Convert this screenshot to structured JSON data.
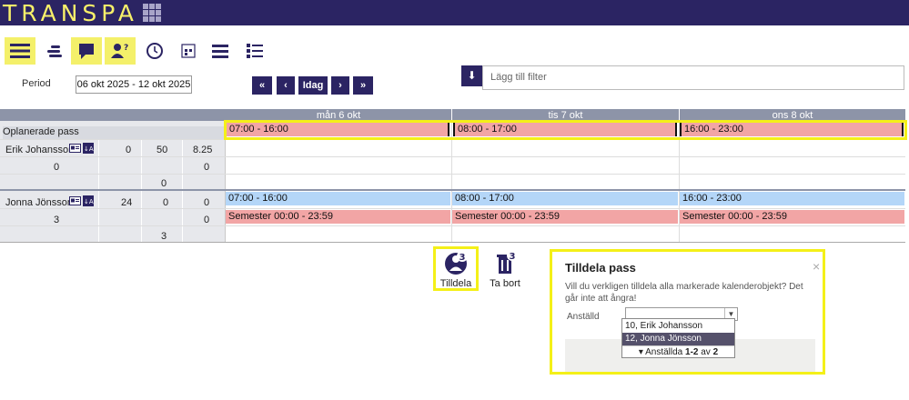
{
  "app": {
    "title": "TRANSPA"
  },
  "toolbar": {
    "icons": [
      "menu-icon",
      "list-compact-icon",
      "comment-icon",
      "user-question-icon",
      "clock-icon",
      "calendar-grid-icon",
      "list-icon",
      "list-detail-icon"
    ]
  },
  "period": {
    "label": "Period",
    "value": "06 okt 2025 - 12 okt 2025"
  },
  "nav": {
    "first": "«",
    "prev": "‹",
    "today": "Idag",
    "next": "›",
    "last": "»"
  },
  "filter": {
    "placeholder": "Lägg till filter"
  },
  "days": [
    "mån 6 okt",
    "tis 7 okt",
    "ons 8 okt"
  ],
  "unassigned": {
    "label": "Oplanerade pass",
    "shifts": [
      "07:00 - 16:00",
      "08:00 - 17:00",
      "16:00 - 23:00"
    ]
  },
  "employees": [
    {
      "name": "Erik Johansson",
      "stats_row1": [
        "0",
        "50",
        "8.25"
      ],
      "stats_row2": [
        "0",
        "0"
      ],
      "stats_row3": [
        "0"
      ],
      "shifts": [],
      "absences": []
    },
    {
      "name": "Jonna Jönsson",
      "stats_row1": [
        "24",
        "0",
        "0"
      ],
      "stats_row2": [
        "3",
        "0"
      ],
      "stats_row3": [
        "3"
      ],
      "shifts": [
        "07:00 - 16:00",
        "08:00 - 17:00",
        "16:00 - 23:00"
      ],
      "absences": [
        "Semester 00:00 - 23:59",
        "Semester 00:00 - 23:59",
        "Semester 00:00 - 23:59"
      ]
    }
  ],
  "actions": {
    "assign": {
      "label": "Tilldela",
      "badge": "3"
    },
    "remove": {
      "label": "Ta bort",
      "badge": "3"
    }
  },
  "dialog": {
    "title": "Tilldela pass",
    "close": "×",
    "message": "Vill du verkligen tilldela alla markerade kalenderobjekt? Det går inte att ångra!",
    "field_label": "Anställd",
    "select_value": "",
    "options": [
      "10, Erik Johansson",
      "12, Jonna Jönsson"
    ],
    "footer_prefix": "Anställda",
    "footer_range": "1-2",
    "footer_mid": "av",
    "footer_total": "2"
  },
  "colors": {
    "brand": "#2b2463",
    "accent": "#f4f06a",
    "shift_pink": "#f2a5a5",
    "shift_blue": "#b4d6f8"
  }
}
